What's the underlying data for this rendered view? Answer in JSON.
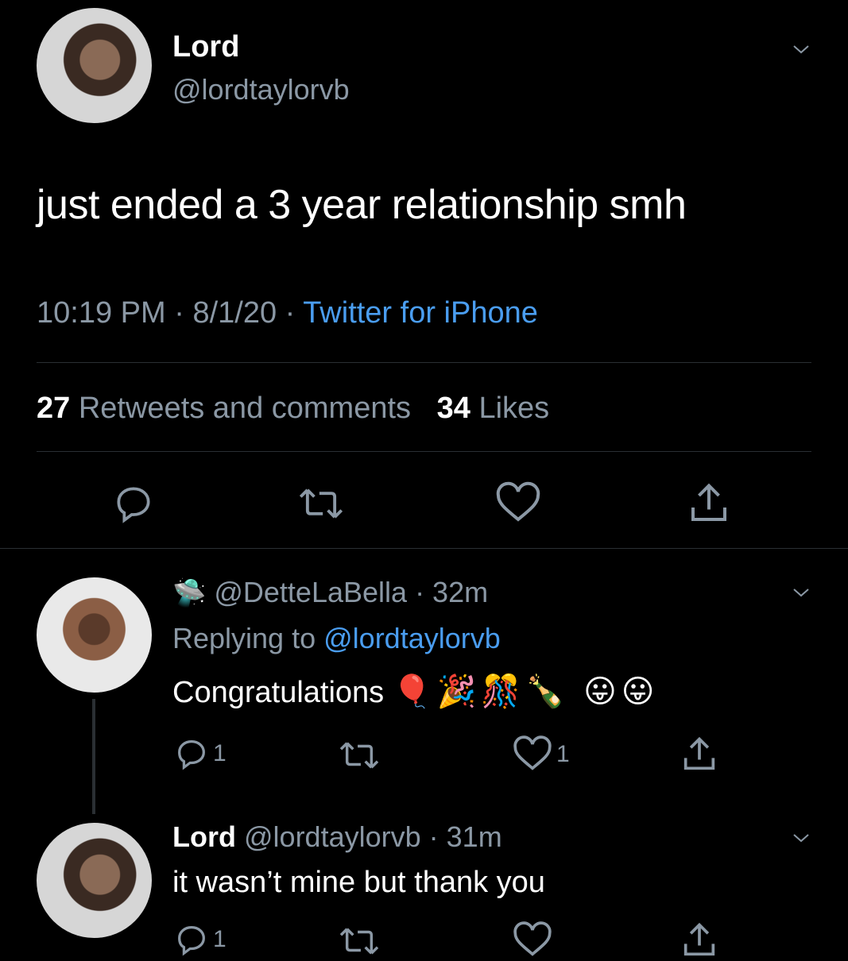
{
  "tweet": {
    "name": "Lord",
    "handle": "@lordtaylorvb",
    "text": "just ended a 3 year relationship smh",
    "time": "10:19 PM",
    "date": "8/1/20",
    "sep": "·",
    "source": "Twitter for iPhone",
    "retweets_count": "27",
    "retweets_label": "Retweets and comments",
    "likes_count": "34",
    "likes_label": "Likes"
  },
  "reply1": {
    "badge": "🛸",
    "handle": "@DetteLaBella",
    "time": "· 32m",
    "replying_prefix": "Replying to",
    "replying_handle": "@lordtaylorvb",
    "text": "Congratulations",
    "emojis": "🎈🎉🎊🍾 😛😛",
    "reply_count": "1",
    "like_count": "1"
  },
  "reply2": {
    "name": "Lord",
    "handle": "@lordtaylorvb",
    "time": "· 31m",
    "text": "it wasn’t mine but thank you",
    "reply_count": "1"
  },
  "colors": {
    "background": "#000000",
    "muted": "#8b98a5",
    "link": "#4a9df0",
    "divider": "#2a2f33"
  }
}
